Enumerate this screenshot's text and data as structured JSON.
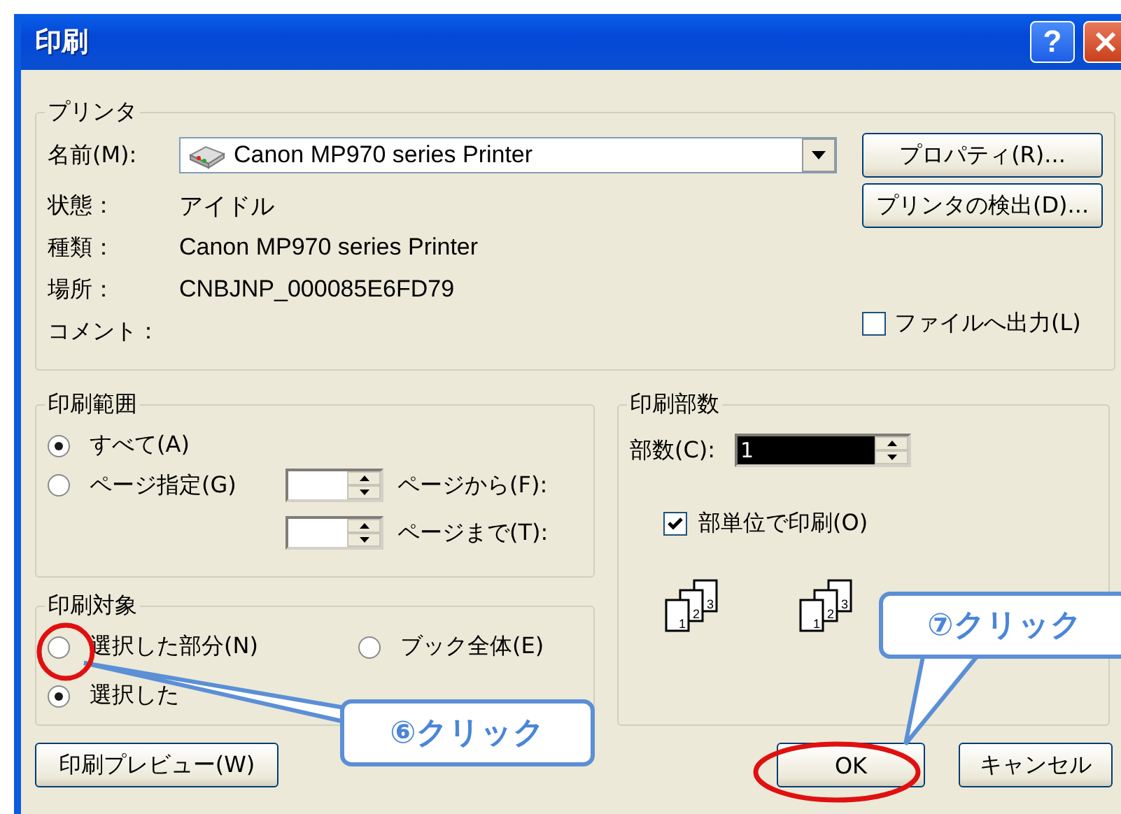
{
  "window": {
    "title": "印刷",
    "help_button": "?"
  },
  "printer": {
    "legend": "プリンタ",
    "name_label": "名前(M):",
    "name_value": "Canon MP970 series Printer",
    "properties_button": "プロパティ(R)...",
    "find_button": "プリンタの検出(D)...",
    "info": [
      {
        "label": "状態：",
        "value": "アイドル"
      },
      {
        "label": "種類：",
        "value": "Canon MP970 series Printer"
      },
      {
        "label": "場所：",
        "value": "CNBJNP_000085E6FD79"
      },
      {
        "label": "コメント："
      }
    ],
    "print_to_file": {
      "label": "ファイルへ出力(L)",
      "checked": false
    }
  },
  "print_range": {
    "legend": "印刷範囲",
    "options": [
      {
        "label": "すべて(A)",
        "selected": true
      },
      {
        "label": "ページ指定(G)",
        "selected": false
      }
    ],
    "from_label": "ページから(F):",
    "to_label": "ページまで(T):"
  },
  "print_what": {
    "legend": "印刷対象",
    "options": [
      {
        "label": "選択した部分(N)",
        "selected": false
      },
      {
        "label": "ブック全体(E)",
        "selected": false
      },
      {
        "label": "選択した",
        "selected": true
      }
    ]
  },
  "copies": {
    "legend": "印刷部数",
    "label": "部数(C):",
    "value": "1",
    "collate": {
      "label": "部単位で印刷(O)",
      "checked": true
    },
    "page_stacks": [
      {
        "pages": [
          "1",
          "2",
          "3"
        ]
      },
      {
        "pages": [
          "1",
          "2",
          "3"
        ]
      }
    ]
  },
  "buttons": {
    "preview": "印刷プレビュー(W)",
    "ok": "OK",
    "cancel": "キャンセル"
  },
  "annotations": [
    {
      "text": "⑥クリック"
    },
    {
      "text": "⑦クリック"
    }
  ]
}
